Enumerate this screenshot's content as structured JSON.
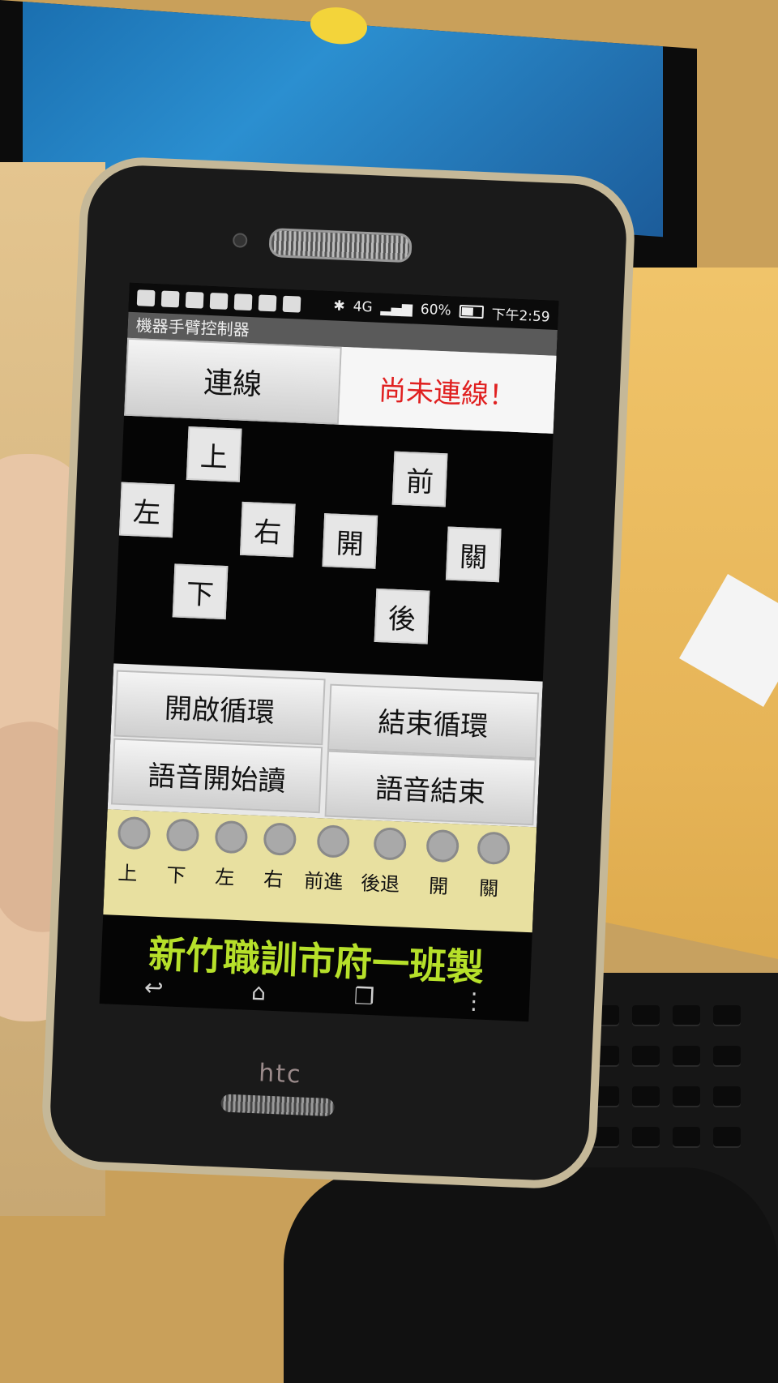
{
  "app": {
    "title": "機器手臂控制器",
    "status_time": "下午2:59",
    "battery": "60%",
    "signal": "4G"
  },
  "connect": {
    "button_label": "連線",
    "status_text": "尚未連線！",
    "status_color": "#e02020"
  },
  "pad": {
    "up": "上",
    "down": "下",
    "left": "左",
    "right": "右",
    "forward": "前",
    "back": "後",
    "open": "開",
    "close": "關"
  },
  "controls": {
    "loop_start": "開啟循環",
    "loop_end": "結束循環",
    "voice_start": "語音開始讀",
    "voice_end": "語音結束"
  },
  "indicators": [
    {
      "label": "上"
    },
    {
      "label": "下"
    },
    {
      "label": "左"
    },
    {
      "label": "右"
    },
    {
      "label": "前進"
    },
    {
      "label": "後退"
    },
    {
      "label": "開"
    },
    {
      "label": "關"
    }
  ],
  "credit": {
    "text": "新竹職訓市府一班製",
    "color": "#b6e02a"
  },
  "device": {
    "brand": "htc"
  },
  "nav": {
    "back_icon": "back-icon",
    "home_icon": "home-icon",
    "recent_icon": "recent-apps-icon"
  }
}
